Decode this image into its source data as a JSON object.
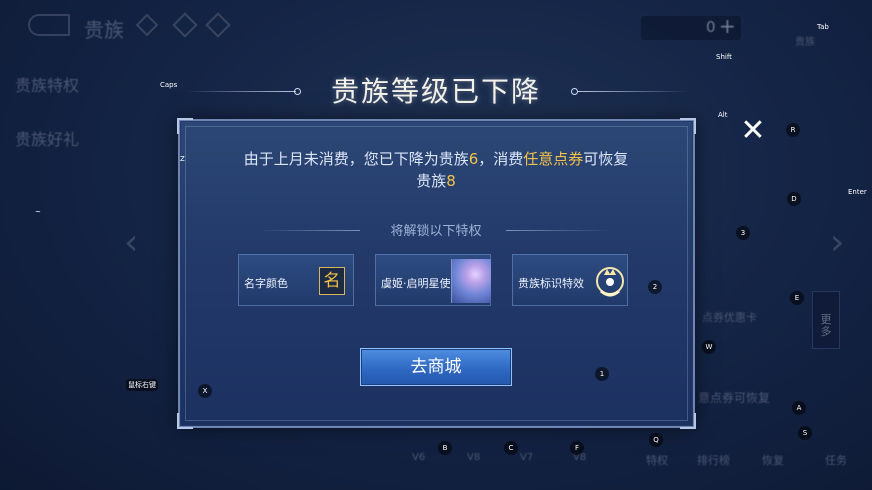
{
  "background": {
    "title": "贵族",
    "menu": [
      "贵族特权",
      "贵族好礼"
    ],
    "currency_value": "0",
    "currency_plus": "+",
    "promo_card": "点券优惠卡",
    "restore_banner": "意点券可恢复",
    "more_label": "更\n多",
    "bottom_labels": [
      "V6",
      "V8",
      "V7",
      "V8",
      "特权",
      "排行榜",
      "恢复",
      "任务"
    ],
    "top_right_label": "贵族"
  },
  "dialog": {
    "title": "贵族等级已下降",
    "message_part1": "由于上月未消费，您已下降为贵族",
    "current_level": "6",
    "message_part2": "，消费",
    "currency_name": "任意点券",
    "message_part3": "可恢复",
    "message_part4": "贵族",
    "target_level": "8",
    "unlock_heading": "将解锁以下特权",
    "privileges": [
      {
        "label": "名字颜色",
        "icon": "name-color-icon",
        "glyph": "名"
      },
      {
        "label": "虞姬·启明星使",
        "icon": "skin-portrait-icon"
      },
      {
        "label": "贵族标识特效",
        "icon": "noble-emblem-icon"
      }
    ],
    "cta_label": "去商城",
    "close_icon": "close-icon"
  },
  "key_hints": [
    {
      "key": "Caps"
    },
    {
      "key": "Tab"
    },
    {
      "key": "Shift"
    },
    {
      "key": "Alt"
    },
    {
      "key": "R"
    },
    {
      "key": "Z"
    },
    {
      "key": "D"
    },
    {
      "key": "Enter"
    },
    {
      "key": "~"
    },
    {
      "key": "3"
    },
    {
      "key": "2"
    },
    {
      "key": "E"
    },
    {
      "key": "W"
    },
    {
      "key": "1"
    },
    {
      "key": "X"
    },
    {
      "key": "A"
    },
    {
      "key": "S"
    },
    {
      "key": "B"
    },
    {
      "key": "C"
    },
    {
      "key": "F"
    },
    {
      "key": "Q"
    },
    {
      "key": "鼠标右键"
    }
  ],
  "colors": {
    "highlight": "#f4c248",
    "panel": "#22396a",
    "button": "#2f69c3"
  }
}
